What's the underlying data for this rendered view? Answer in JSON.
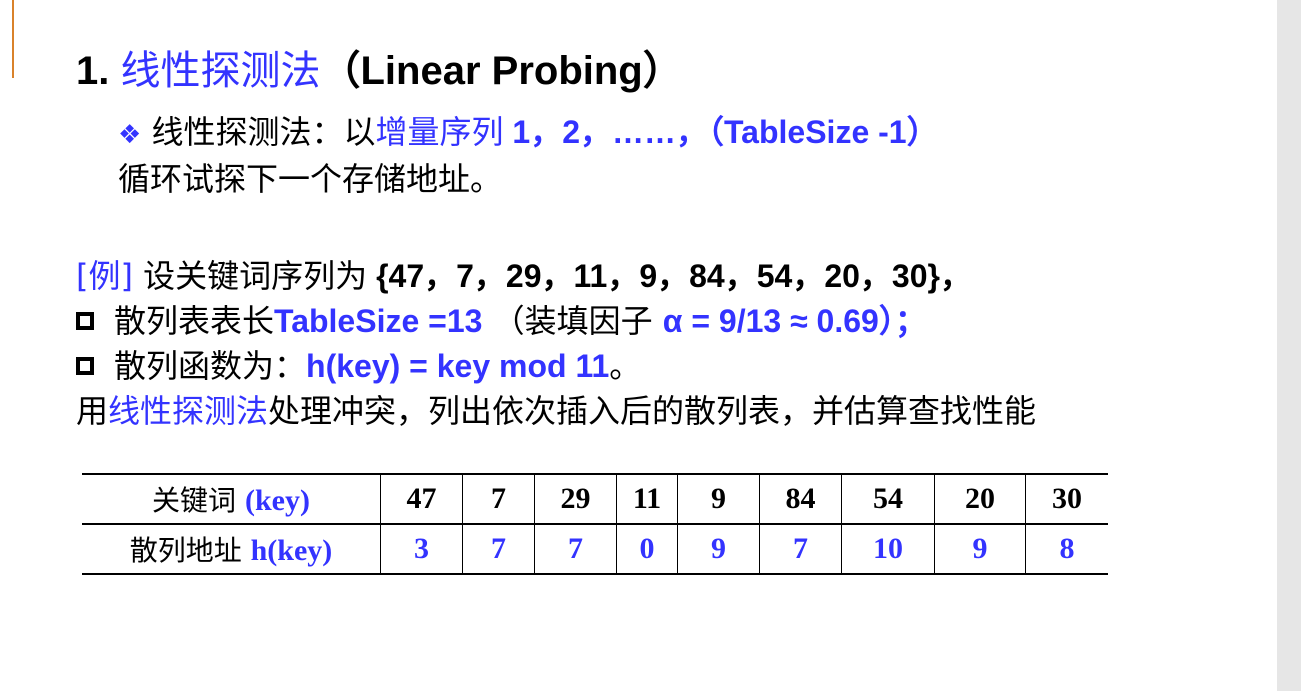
{
  "title": {
    "number": "1. ",
    "cn": "线性探测法",
    "en": "（Linear Probing）"
  },
  "bullet": {
    "icon": "diamond-bullet-icon",
    "symbol": "❖",
    "p1": " 线性探测法：以",
    "p2": "增量序列",
    "p3": " 1，2，……，（TableSize -1）",
    "line2": "循环试探下一个存储地址。"
  },
  "example": {
    "tag": "[例]",
    "line1_text": " 设关键词序列为",
    "line1_seq": " {47，7，29，11，9，84，54，20，30}，",
    "line2_a": "散列表表长",
    "line2_b": "TableSize =13",
    "line2_c": " （装填因子 ",
    "line2_d": "α =  9/13 ≈ 0.69）；",
    "line3_a": "散列函数为：",
    "line3_b": "h(key) = key mod 11",
    "line3_c": "。",
    "line4_a": "用",
    "line4_b": "线性探测法",
    "line4_c": "处理冲突，列出依次插入后的散列表，并估算查找性能"
  },
  "table": {
    "row1_label": "关键词 ",
    "row1_key": "(key)",
    "row2_label": "散列地址 ",
    "row2_key": "h(key)",
    "keys": [
      "47",
      "7",
      "29",
      "11",
      "9",
      "84",
      "54",
      "20",
      "30"
    ],
    "addrs": [
      "3",
      "7",
      "7",
      "0",
      "9",
      "7",
      "10",
      "9",
      "8"
    ]
  },
  "colors": {
    "accent_blue": "#3333ff",
    "accent_orange": "#d9822b",
    "right_bar": "#e6e6e6"
  }
}
